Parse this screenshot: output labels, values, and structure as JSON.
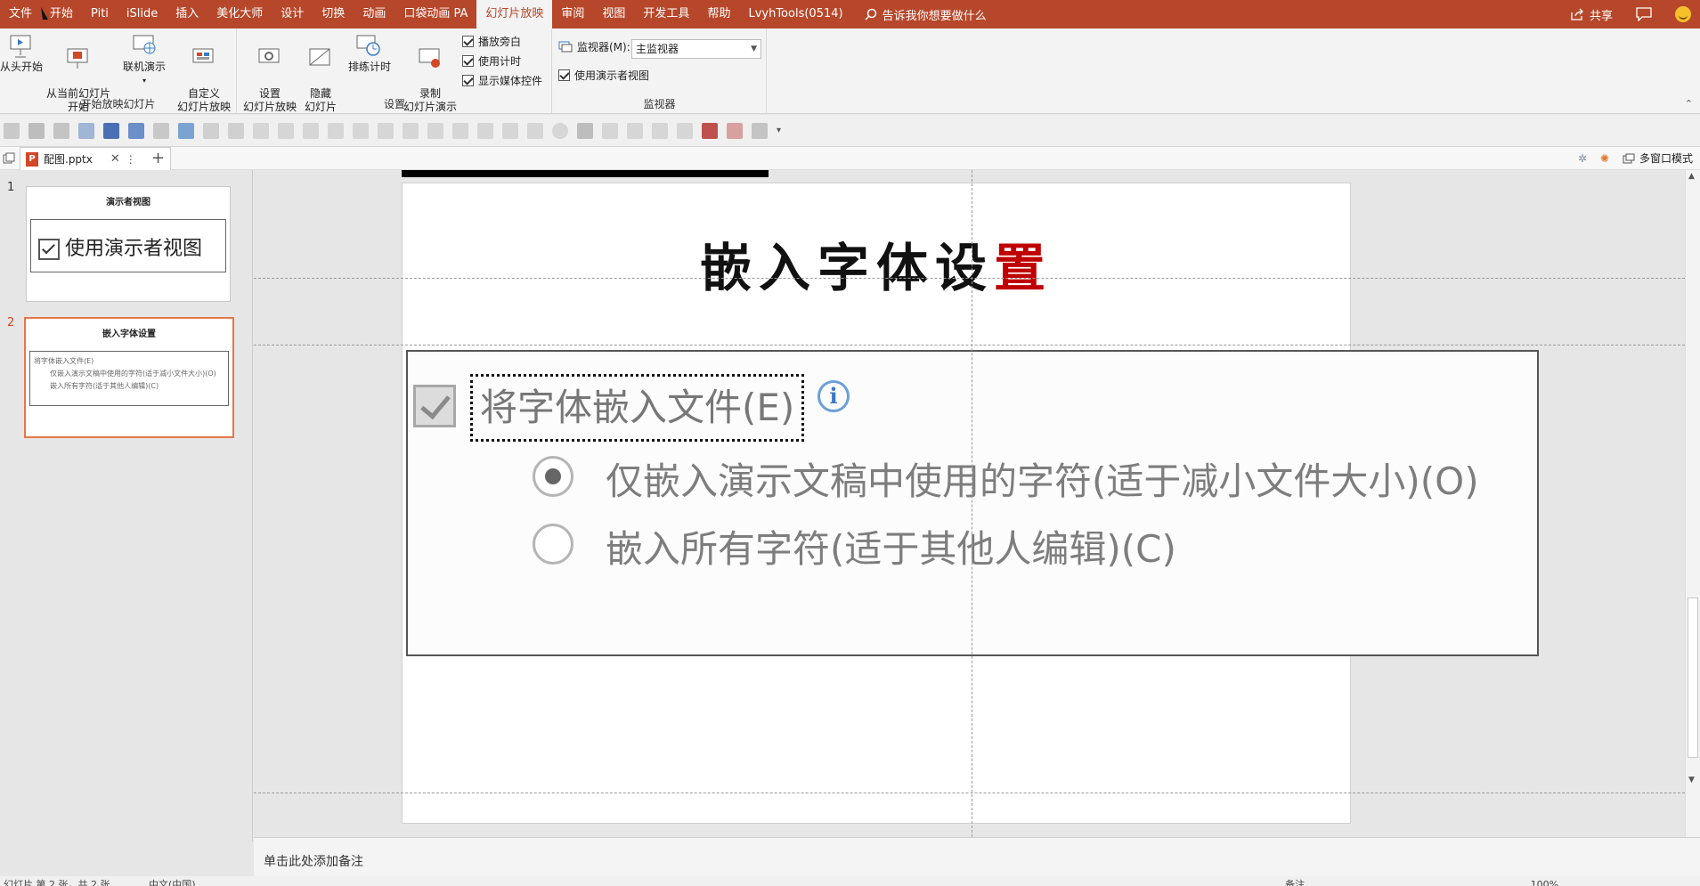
{
  "menubar": {
    "items": [
      "文件",
      "开始",
      "Piti",
      "iSlide",
      "插入",
      "美化大师",
      "设计",
      "切换",
      "动画",
      "口袋动画 PA",
      "幻灯片放映",
      "审阅",
      "视图",
      "开发工具",
      "帮助",
      "LvyhTools(0514)"
    ],
    "active": "幻灯片放映",
    "tell_me": "告诉我你想要做什么",
    "share": "共享"
  },
  "ribbon": {
    "group1": {
      "label": "开始放映幻灯片",
      "buttons": [
        {
          "label": "从头开始",
          "icon": "presentation-from-start-icon"
        },
        {
          "label": "从当前幻灯片\n开始",
          "icon": "presentation-from-current-icon"
        },
        {
          "label": "联机演示",
          "icon": "online-present-icon"
        },
        {
          "label": "自定义\n幻灯片放映",
          "icon": "custom-show-icon"
        }
      ]
    },
    "group2": {
      "label": "设置",
      "buttons": [
        {
          "label": "设置\n幻灯片放映",
          "icon": "setup-show-icon"
        },
        {
          "label": "隐藏\n幻灯片",
          "icon": "hide-slide-icon"
        },
        {
          "label": "排练计时",
          "icon": "rehearse-timings-icon"
        },
        {
          "label": "录制\n幻灯片演示",
          "icon": "record-show-icon"
        }
      ],
      "checks": [
        {
          "label": "播放旁白",
          "checked": true
        },
        {
          "label": "使用计时",
          "checked": true
        },
        {
          "label": "显示媒体控件",
          "checked": true
        }
      ]
    },
    "group3": {
      "label": "监视器",
      "monitor_label": "监视器(M):",
      "monitor_value": "主监视器",
      "presenter_view": {
        "label": "使用演示者视图",
        "checked": true
      }
    }
  },
  "tab": {
    "filename": "配图.pptx"
  },
  "toolbar_right": {
    "multi_window": "多窗口模式"
  },
  "thumbnails": [
    {
      "number": "1",
      "title": "演示者视图",
      "box_text": "使用演示者视图",
      "selected": false
    },
    {
      "number": "2",
      "title": "嵌入字体设置",
      "line1": "将字体嵌入文件(E)",
      "line2": "仅嵌入演示文稿中使用的字符(适于减小文件大小)(O)",
      "line3": "嵌入所有字符(适于其他人编辑)(C)",
      "selected": true
    }
  ],
  "slide": {
    "title_main": "嵌入字体设",
    "title_red": "置",
    "embed_checkbox_label": "将字体嵌入文件(E)",
    "embed_checked": true,
    "info_glyph": "i",
    "options": [
      {
        "label": "仅嵌入演示文稿中使用的字符(适于减小文件大小)(O)",
        "selected": true
      },
      {
        "label": "嵌入所有字符(适于其他人编辑)(C)",
        "selected": false
      }
    ]
  },
  "notes": {
    "placeholder": "单击此处添加备注"
  },
  "statusbar": {
    "slide_info": "幻灯片 第 2 张，共 2 张",
    "language": "中文(中国)",
    "notes": "备注",
    "zoom": "100%"
  }
}
